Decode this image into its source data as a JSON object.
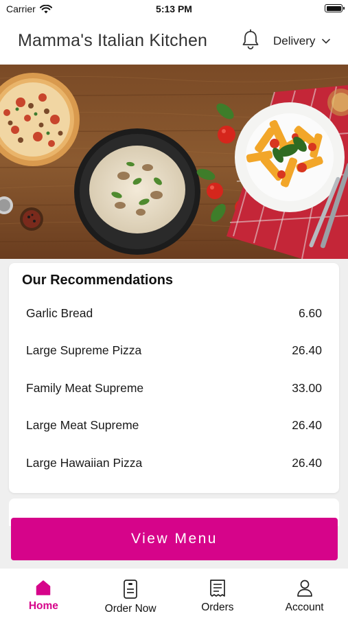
{
  "status": {
    "carrier": "Carrier",
    "time": "5:13 PM"
  },
  "header": {
    "title": "Mamma's Italian Kitchen",
    "mode": "Delivery"
  },
  "recommendations": {
    "title": "Our Recommendations",
    "items": [
      {
        "name": "Garlic Bread",
        "price": "6.60"
      },
      {
        "name": "Large Supreme Pizza",
        "price": "26.40"
      },
      {
        "name": "Family Meat Supreme",
        "price": "33.00"
      },
      {
        "name": "Large Meat Supreme",
        "price": "26.40"
      },
      {
        "name": "Large Hawaiian Pizza",
        "price": "26.40"
      }
    ]
  },
  "cta": {
    "label": "View Menu"
  },
  "tabs": [
    {
      "label": "Home",
      "icon": "home-icon"
    },
    {
      "label": "Order Now",
      "icon": "phone-icon"
    },
    {
      "label": "Orders",
      "icon": "receipt-icon"
    },
    {
      "label": "Account",
      "icon": "person-icon"
    }
  ],
  "colors": {
    "accent": "#d6048a"
  }
}
